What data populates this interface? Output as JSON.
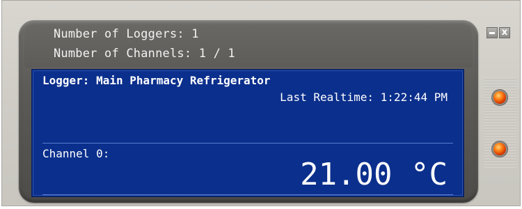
{
  "summary": {
    "loggers_text": "Number of Loggers: 1",
    "channels_text": "Number of Channels: 1 / 1"
  },
  "logger": {
    "name_text": "Logger: Main Pharmacy Refrigerator",
    "last_realtime_text": "Last Realtime: 1:22:44 PM"
  },
  "channel": {
    "label": "Channel 0:",
    "reading": "21.00 °C"
  },
  "window_controls": {
    "minimize_icon": "minimize-icon",
    "close_icon": "close-icon",
    "close_glyph": "x"
  },
  "indicators": [
    {
      "icon": "status-led-icon",
      "color": "#e8490f"
    },
    {
      "icon": "status-led-icon",
      "color": "#e8490f"
    }
  ],
  "colors": {
    "screen_bg": "#0b2f8c",
    "bezel": "#5c5a57",
    "frame": "#d9d6d0",
    "led": "#e8490f"
  }
}
